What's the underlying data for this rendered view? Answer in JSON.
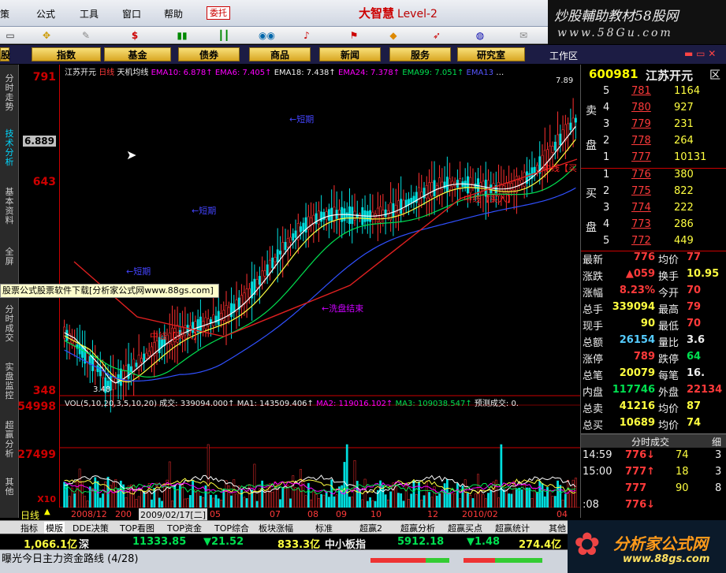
{
  "menu": {
    "items": [
      "策",
      "公式",
      "工具",
      "窗口",
      "帮助"
    ],
    "wt_label": "委托",
    "brand": "大智慧",
    "brand_level": "Level-2"
  },
  "promo": {
    "line1": "炒股輔助教材58股网",
    "line2": "www.58Gu.com"
  },
  "nav": {
    "items": [
      "股",
      "指数",
      "基金",
      "债券",
      "商品",
      "新闻",
      "服务",
      "研究室"
    ],
    "workarea": "工作区"
  },
  "sidetabs": [
    "分时走势",
    "技术分析",
    "基本资料",
    "全屏",
    "分时成交",
    "实盘监控",
    "超赢分析",
    "其他"
  ],
  "chart_header": {
    "name": "江苏开元",
    "period": "日线",
    "indicator": "天机均线",
    "ema": [
      "EMA10: 6.878↑",
      "EMA6: 7.405↑",
      "EMA18: 7.438↑",
      "EMA24: 7.378↑",
      "EMA99: 7.051↑",
      "EMA13",
      "…"
    ],
    "last_price": "7.89"
  },
  "vol_header": {
    "text": "VOL(5,10,20,3,5,10,20)",
    "items": [
      "成交: 339094.000↑",
      "MA1: 143509.406↑",
      "MA2: 119016.102↑",
      "MA3: 109038.547↑",
      "预测成交: 0."
    ]
  },
  "yaxis": {
    "labels": [
      "791",
      "6.889",
      "643",
      "348",
      "54998",
      "27499",
      "X10"
    ]
  },
  "annotations": {
    "a1": "←短期",
    "a2": "←短期",
    "a3": "←短期",
    "a4": "←洗盘结束",
    "a5": "中线【买入】",
    "a6": "中线【买入】",
    "a7": "中线【买",
    "a8": "3.48"
  },
  "tooltip": "股票公式股票软件下载[分析家公式网www.88gs.com]",
  "xaxis": {
    "labels": [
      "2008/12",
      "200",
      "2009/02/17[二]",
      "05",
      "07",
      "08",
      "09",
      "10",
      "12",
      "2010/02",
      "04"
    ],
    "period_label": "日线"
  },
  "bottomtabs": [
    "指标",
    "模版",
    "DDE决策",
    "TOP看图",
    "TOP资金",
    "TOP综合",
    "板块涨幅",
    "标准",
    "超赢2",
    "超赢分析",
    "超赢买点",
    "超赢统计",
    "其他"
  ],
  "ticker": {
    "v1": "1,066.1亿",
    "v1b": "深",
    "v2": "11333.85",
    "v3": "▼21.52",
    "v4": "833.3亿",
    "v5": "中小板指",
    "v6": "5912.18",
    "v7": "▼1.48",
    "v8": "274.4亿"
  },
  "status_msg": "曝光今日主力资金路线 (4/28)",
  "quote": {
    "code": "600981",
    "name": "江苏开元",
    "x": "区",
    "sell": [
      {
        "n": "5",
        "p": "781",
        "v": "1164"
      },
      {
        "n": "4",
        "p": "780",
        "v": "927"
      },
      {
        "n": "3",
        "p": "779",
        "v": "231"
      },
      {
        "n": "2",
        "p": "778",
        "v": "264"
      },
      {
        "n": "1",
        "p": "777",
        "v": "10131"
      }
    ],
    "buy": [
      {
        "n": "1",
        "p": "776",
        "v": "380"
      },
      {
        "n": "2",
        "p": "775",
        "v": "822"
      },
      {
        "n": "3",
        "p": "774",
        "v": "222"
      },
      {
        "n": "4",
        "p": "773",
        "v": "286"
      },
      {
        "n": "5",
        "p": "772",
        "v": "449"
      }
    ],
    "sell_label": [
      "卖",
      "盘"
    ],
    "buy_label": [
      "买",
      "盘"
    ],
    "stats": [
      {
        "l": "最新",
        "v": "776",
        "l2": "均价",
        "v2": "77"
      },
      {
        "l": "涨跌",
        "v": "▲059",
        "l2": "换手",
        "v2": "10.95"
      },
      {
        "l": "涨幅",
        "v": "8.23%",
        "l2": "今开",
        "v2": "70"
      },
      {
        "l": "总手",
        "v": "339094",
        "l2": "最高",
        "v2": "79"
      },
      {
        "l": "现手",
        "v": "90",
        "l2": "最低",
        "v2": "70"
      },
      {
        "l": "总额",
        "v": "26154",
        "l2": "量比",
        "v2": "3.6"
      },
      {
        "l": "涨停",
        "v": "789",
        "l2": "跌停",
        "v2": "64"
      },
      {
        "l": "总笔",
        "v": "20079",
        "l2": "每笔",
        "v2": "16."
      },
      {
        "l": "内盘",
        "v": "117746",
        "l2": "外盘",
        "v2": "22134"
      },
      {
        "l": "总卖",
        "v": "41216",
        "l2": "均价",
        "v2": "87"
      },
      {
        "l": "总买",
        "v": "10689",
        "l2": "均价",
        "v2": "74"
      }
    ],
    "trades_header": "分时成交",
    "trades_tab2": "细",
    "trades": [
      {
        "t": "14:59",
        "p": "776↓",
        "v": "74",
        "n": "3"
      },
      {
        "t": "15:00",
        "p": "777↑",
        "v": "18",
        "n": "3"
      },
      {
        "t": "",
        "p": "777",
        "v": "90",
        "n": "8"
      },
      {
        "t": ":08",
        "p": "776↓",
        "v": "",
        "n": ""
      }
    ]
  },
  "logo": {
    "title": "分析家公式网",
    "url": "www.88gs.com"
  }
}
